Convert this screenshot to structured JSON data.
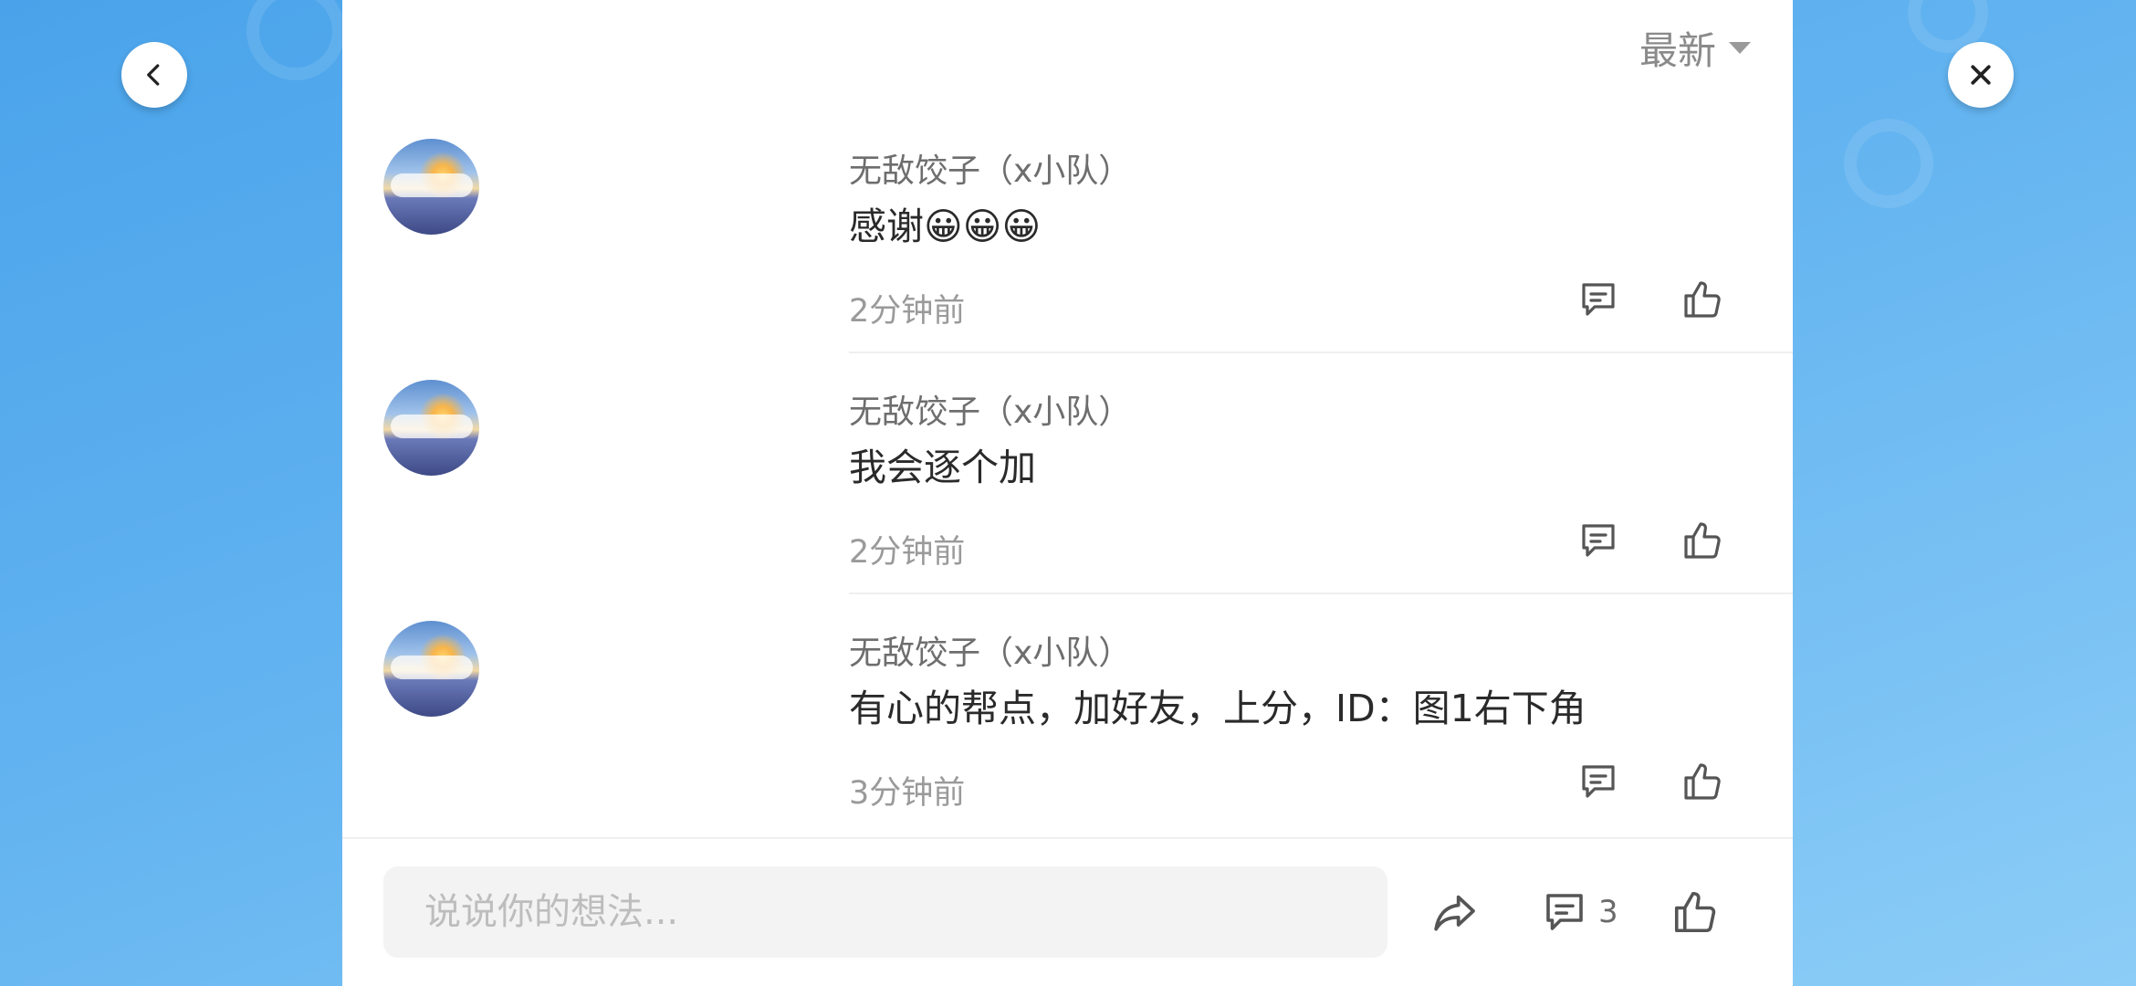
{
  "sort": {
    "label": "最新"
  },
  "comments": [
    {
      "user": "无敌饺子（x小队）",
      "text": "感谢😀😀😀",
      "time": "2分钟前"
    },
    {
      "user": "无敌饺子（x小队）",
      "text": "我会逐个加",
      "time": "2分钟前"
    },
    {
      "user": "无敌饺子（x小队）",
      "text": "有心的帮点，加好友，上分，ID：图1右下角",
      "time": "3分钟前"
    }
  ],
  "input": {
    "placeholder": "说说你的想法..."
  },
  "bottom": {
    "comment_count": "3"
  },
  "icons": {
    "back": "chevron-left-icon",
    "close": "close-icon",
    "sort_caret": "caret-down-icon",
    "reply": "comment-icon",
    "like": "thumbs-up-icon",
    "share": "share-icon"
  },
  "colors": {
    "background_top": "#4aa3ea",
    "background_bottom": "#8ccdf7",
    "panel": "#ffffff",
    "icon": "#555555"
  }
}
